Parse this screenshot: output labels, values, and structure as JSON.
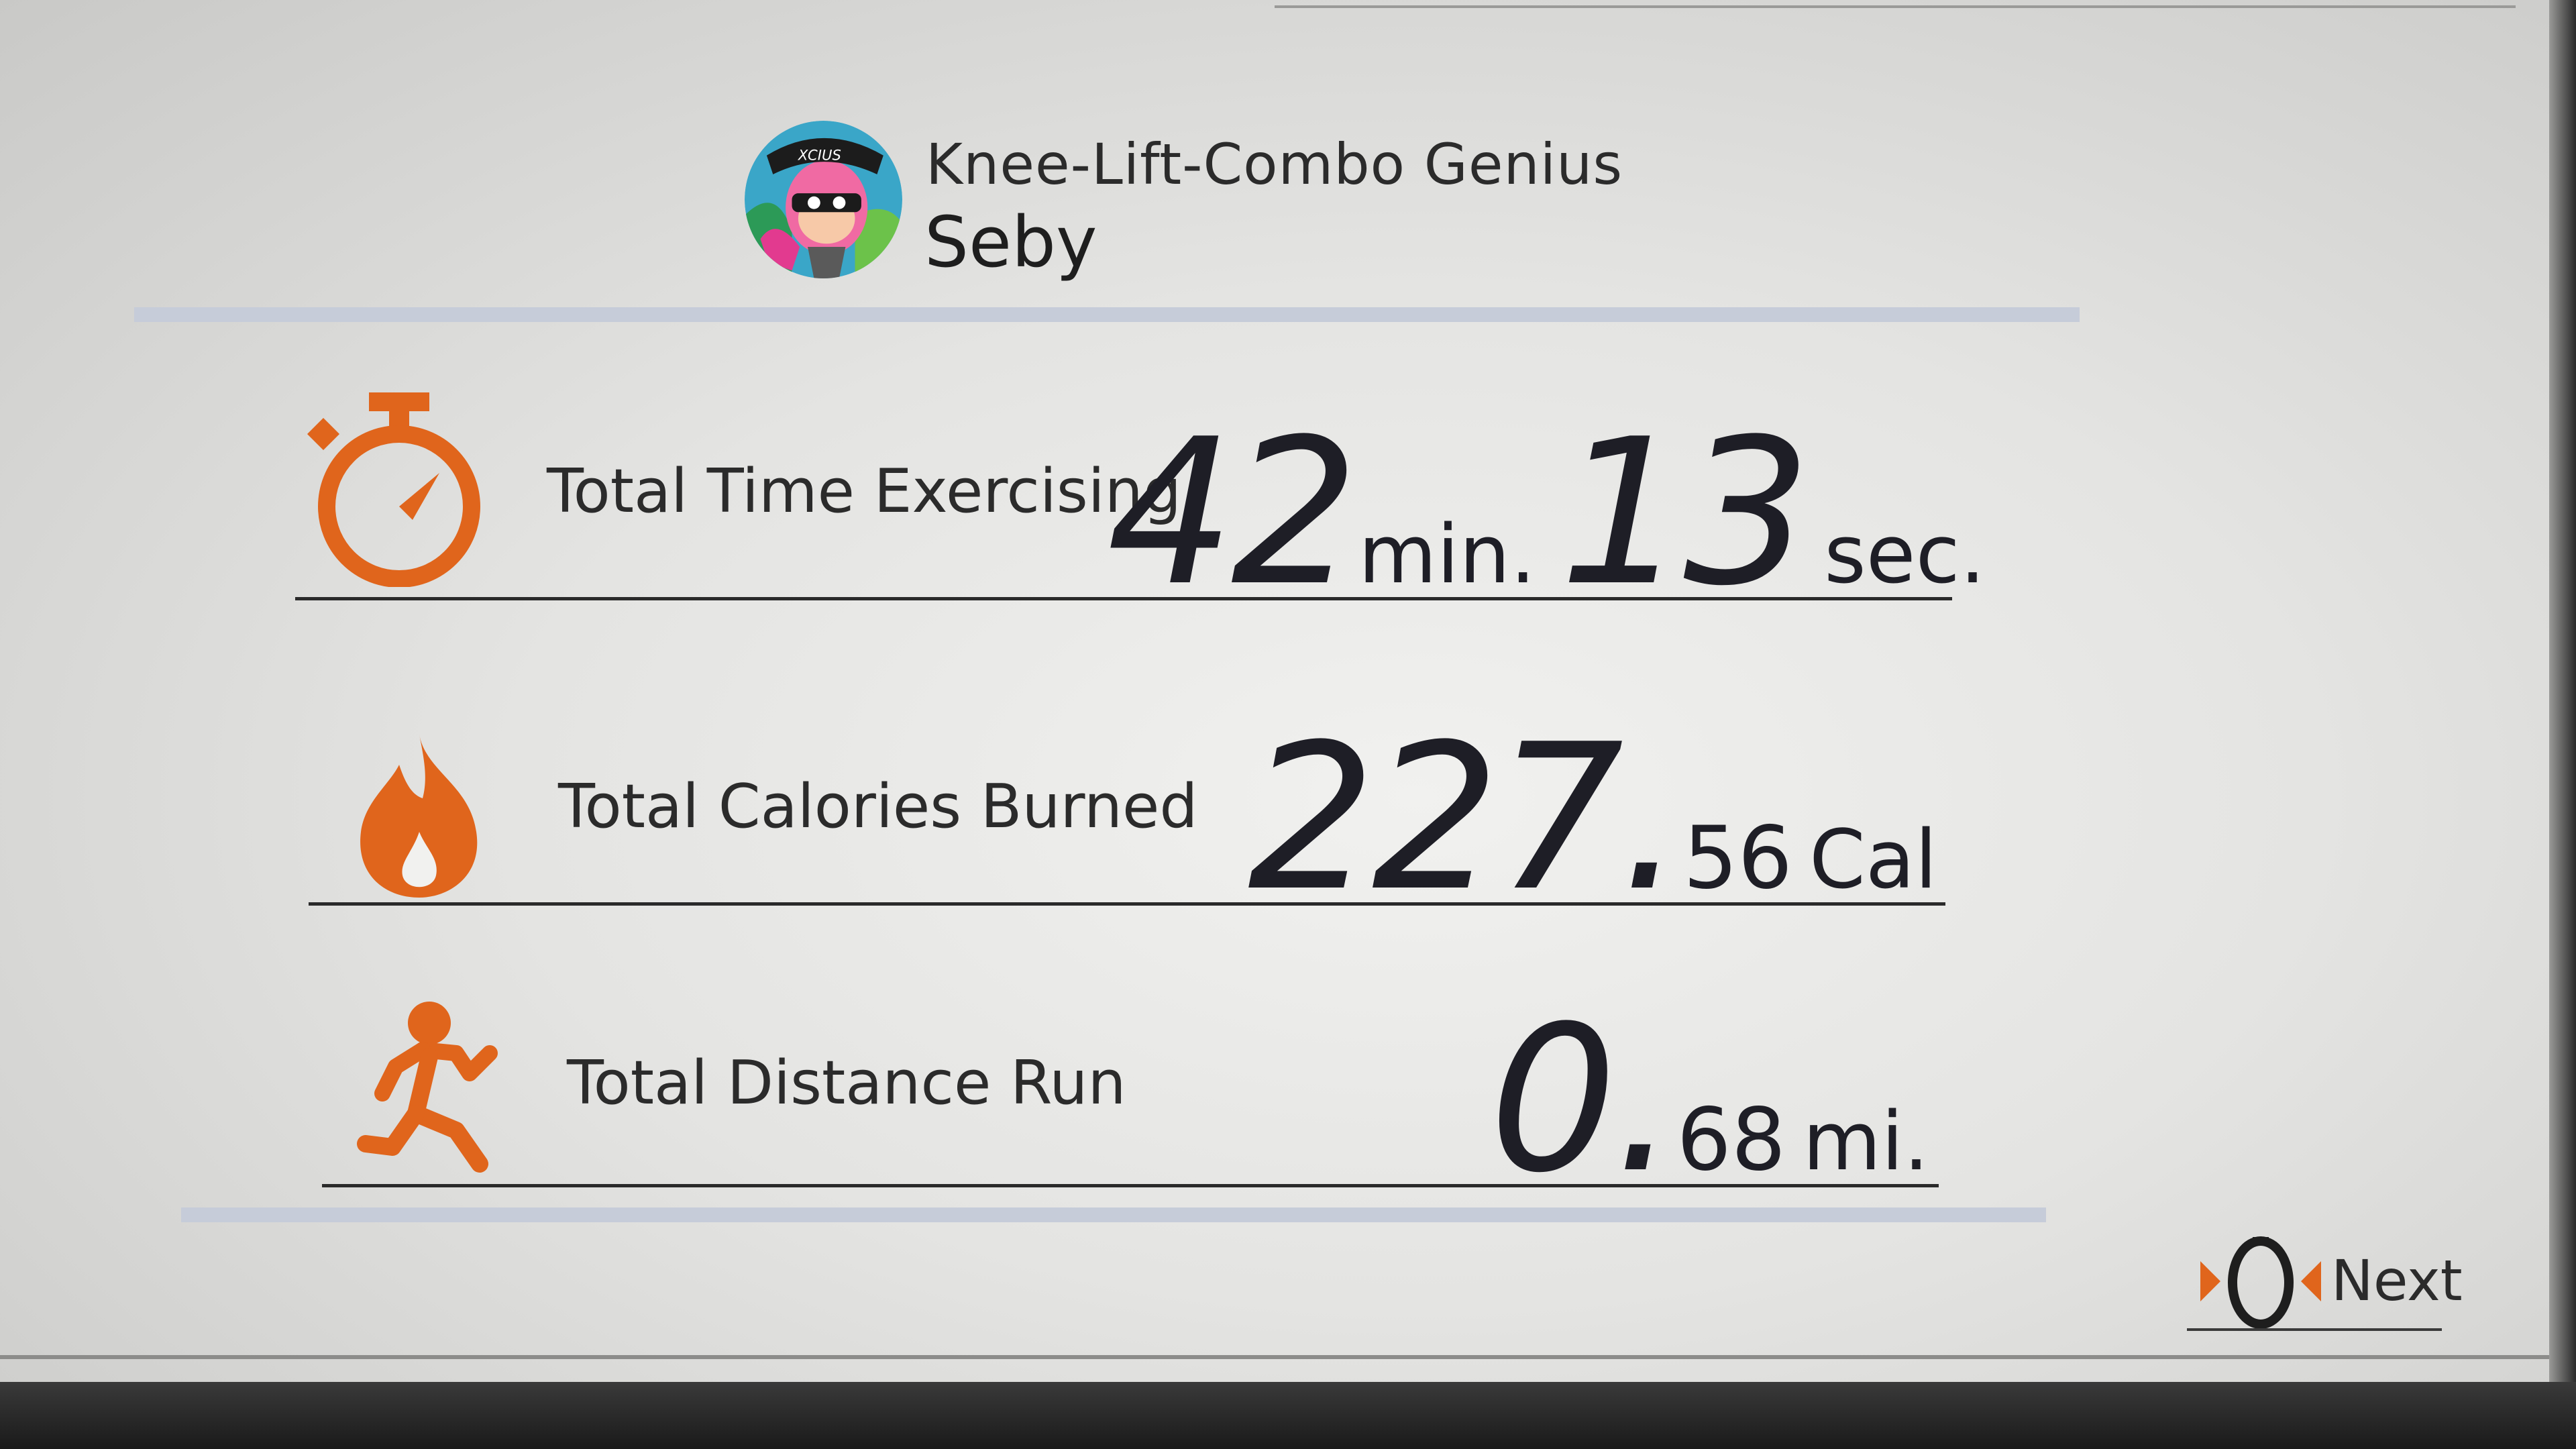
{
  "profile": {
    "title": "Knee-Lift-Combo Genius",
    "name": "Seby",
    "avatar_badge": "XCIUS"
  },
  "stats": [
    {
      "icon": "stopwatch-icon",
      "label": "Total Time Exercising",
      "minutes": "42",
      "minutes_unit": "min.",
      "seconds": "13",
      "seconds_unit": "sec."
    },
    {
      "icon": "flame-icon",
      "label": "Total Calories Burned",
      "integer": "227.",
      "fraction": "56",
      "unit": "Cal"
    },
    {
      "icon": "runner-icon",
      "label": "Total Distance Run",
      "integer": "0.",
      "fraction": "68",
      "unit": "mi."
    }
  ],
  "next": {
    "label": "Next",
    "icon": "ring-con-squeeze-icon"
  },
  "colors": {
    "accent": "#e0651c",
    "text": "#1e1e26",
    "divider": "#c6ccd9"
  }
}
